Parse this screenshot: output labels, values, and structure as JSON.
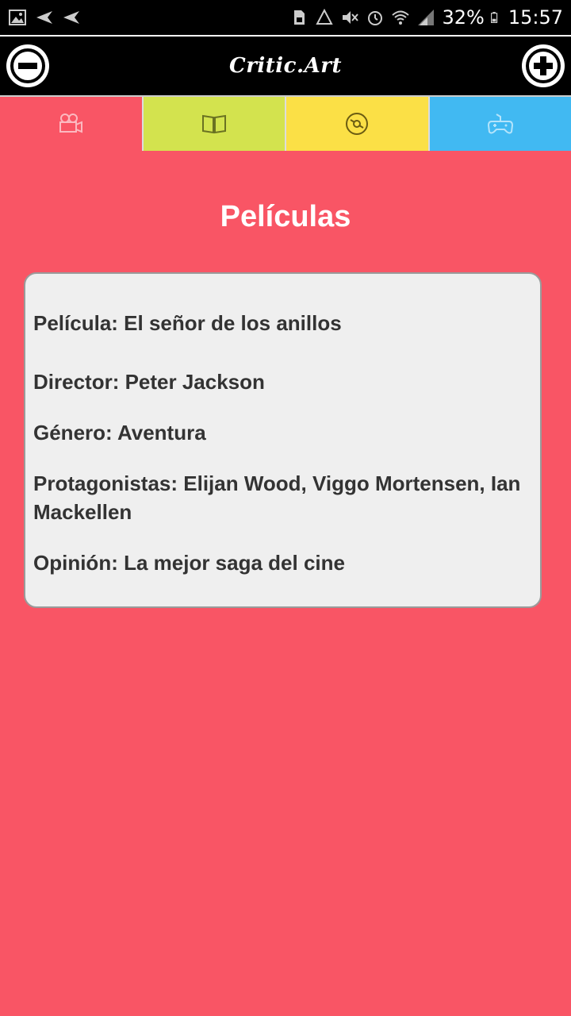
{
  "status_bar": {
    "battery": "32%",
    "time": "15:57"
  },
  "app": {
    "title": "Critic.Art"
  },
  "tabs": [
    {
      "name": "movies",
      "icon": "movie-camera-icon",
      "color": "#f95565",
      "active": true
    },
    {
      "name": "books",
      "icon": "book-icon",
      "color": "#d3e34e",
      "active": false
    },
    {
      "name": "music",
      "icon": "disc-icon",
      "color": "#fbe046",
      "active": false
    },
    {
      "name": "games",
      "icon": "gamepad-icon",
      "color": "#41b9f2",
      "active": false
    }
  ],
  "section": {
    "title": "Películas"
  },
  "review": {
    "movie": "Película: El señor de los anillos",
    "director": "Director: Peter Jackson",
    "genre": "Género: Aventura",
    "cast": "Protagonistas: Elijan Wood, Viggo Mortensen, Ian Mackellen",
    "opinion": "Opinión: La mejor saga del cine"
  },
  "colors": {
    "background": "#f95565",
    "card": "#efefef",
    "text": "#333333"
  }
}
